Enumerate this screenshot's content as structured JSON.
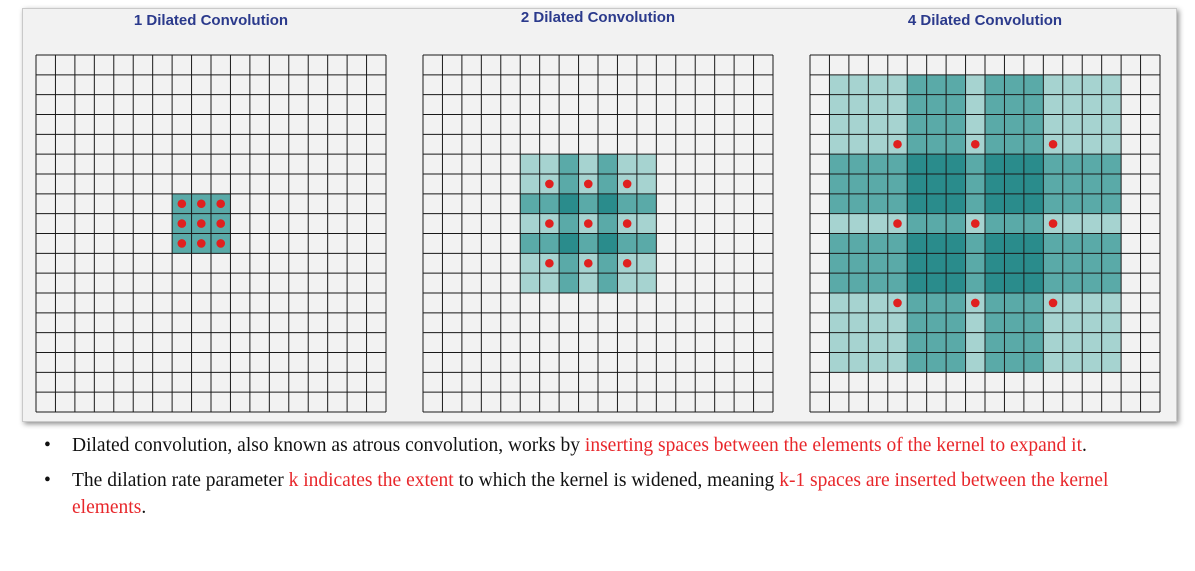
{
  "panels": [
    {
      "title": "1 Dilated Convolution",
      "dilation": 1,
      "grid_size": 18
    },
    {
      "title": "2 Dilated Convolution",
      "dilation": 2,
      "grid_size": 18
    },
    {
      "title": "4 Dilated Convolution",
      "dilation": 4,
      "grid_size": 18
    }
  ],
  "colors": {
    "grid_line": "#1a1a1a",
    "kernel_point": "#e0201f",
    "fill_light": "#a6d3d0",
    "fill_mid": "#5aaaa8",
    "fill_dark": "#2a8c8c",
    "title_text": "#2b3a8c",
    "highlight_text": "#e8272b"
  },
  "bullets": [
    {
      "segments": [
        {
          "text": "Dilated convolution, also known as atrous convolution, works by ",
          "highlight": false
        },
        {
          "text": "inserting spaces between the elements of the kernel to expand it",
          "highlight": true
        },
        {
          "text": ".",
          "highlight": false
        }
      ]
    },
    {
      "segments": [
        {
          "text": "The dilation rate parameter ",
          "highlight": false
        },
        {
          "text": "k indicates the extent",
          "highlight": true
        },
        {
          "text": " to which the kernel is widened, meaning ",
          "highlight": false
        },
        {
          "text": "k-1 spaces are inserted between the kernel elements",
          "highlight": true
        },
        {
          "text": ".",
          "highlight": false
        }
      ]
    }
  ]
}
